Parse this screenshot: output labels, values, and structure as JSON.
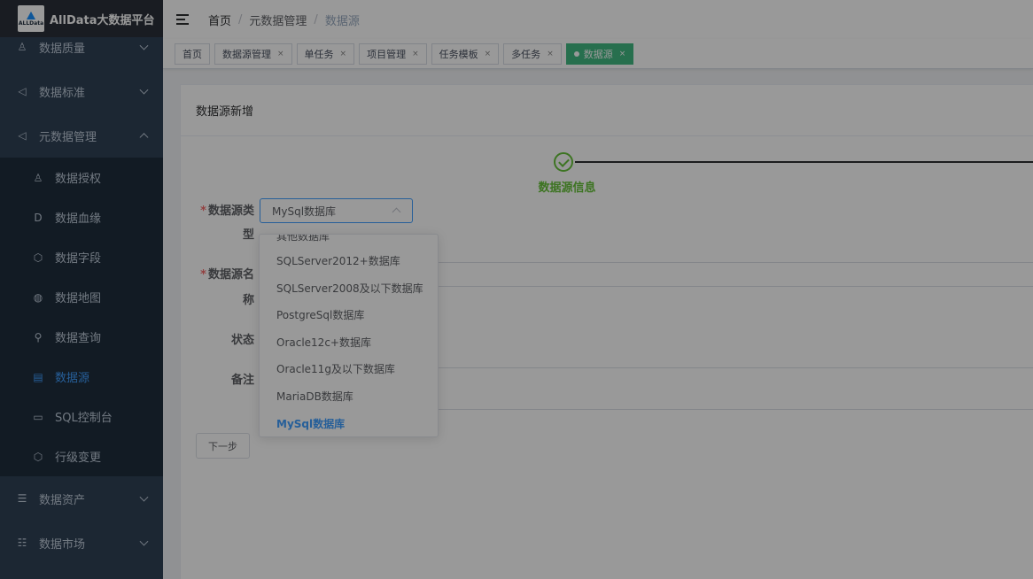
{
  "app": {
    "logo_text": "ALLData",
    "title": "AllData大数据平台"
  },
  "sidebar": {
    "items": [
      {
        "label": "数据质量",
        "icon": "quality-icon",
        "glyph": "♙",
        "expanded": false
      },
      {
        "label": "数据标准",
        "icon": "send-icon",
        "glyph": "◁",
        "expanded": false
      },
      {
        "label": "元数据管理",
        "icon": "send-icon",
        "glyph": "◁",
        "expanded": true
      },
      {
        "label": "数据资产",
        "icon": "database-icon",
        "glyph": "☰",
        "expanded": false
      },
      {
        "label": "数据市场",
        "icon": "tree-icon",
        "glyph": "☷",
        "expanded": false
      }
    ],
    "submenu": [
      {
        "label": "数据授权",
        "icon": "user-icon",
        "glyph": "♙",
        "active": false
      },
      {
        "label": "数据血缘",
        "icon": "d-icon",
        "glyph": "D",
        "active": false
      },
      {
        "label": "数据字段",
        "icon": "cube-icon",
        "glyph": "⬡",
        "active": false
      },
      {
        "label": "数据地图",
        "icon": "globe-icon",
        "glyph": "◍",
        "active": false
      },
      {
        "label": "数据查询",
        "icon": "search-icon",
        "glyph": "⚲",
        "active": false
      },
      {
        "label": "数据源",
        "icon": "list-icon",
        "glyph": "▤",
        "active": true
      },
      {
        "label": "SQL控制台",
        "icon": "monitor-icon",
        "glyph": "▭",
        "active": false
      },
      {
        "label": "行级变更",
        "icon": "cube-icon",
        "glyph": "⬡",
        "active": false
      }
    ]
  },
  "breadcrumb": {
    "home": "首页",
    "parent": "元数据管理",
    "current": "数据源",
    "separator": "/"
  },
  "tags": [
    {
      "label": "首页",
      "closable": false,
      "active": false
    },
    {
      "label": "数据源管理",
      "closable": true,
      "active": false
    },
    {
      "label": "单任务",
      "closable": true,
      "active": false
    },
    {
      "label": "项目管理",
      "closable": true,
      "active": false
    },
    {
      "label": "任务模板",
      "closable": true,
      "active": false
    },
    {
      "label": "多任务",
      "closable": true,
      "active": false
    },
    {
      "label": "数据源",
      "closable": true,
      "active": true
    }
  ],
  "tag_close_glyph": "×",
  "form": {
    "card_title": "数据源新增",
    "step_title": "数据源信息",
    "type_label_1": "数据源类",
    "type_label_2": "型",
    "name_label_1": "数据源名",
    "name_label_2": "称",
    "status_label": "状态",
    "remark_label": "备注",
    "required_mark": "*",
    "selected_type": "MySql数据库",
    "next_button": "下一步"
  },
  "dropdown": {
    "options": [
      "其他数据库",
      "SQLServer2012+数据库",
      "SQLServer2008及以下数据库",
      "PostgreSql数据库",
      "Oracle12c+数据库",
      "Oracle11g及以下数据库",
      "MariaDB数据库",
      "MySql数据库"
    ],
    "selected": "MySql数据库"
  },
  "colors": {
    "sidebar_bg": "#304156",
    "submenu_bg": "#1f2d3d",
    "active_menu": "#409eff",
    "tag_active": "#42b983",
    "step_success": "#67c23a",
    "required": "#f56c6c"
  }
}
